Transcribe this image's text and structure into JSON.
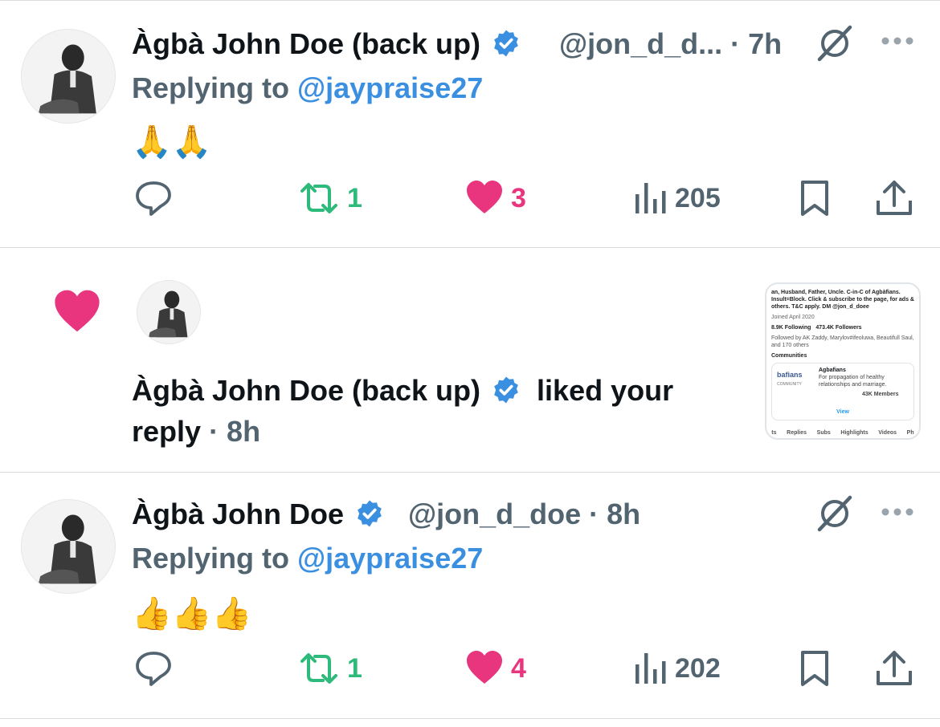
{
  "colors": {
    "accent": "#3b8fe0",
    "like": "#e8357e",
    "retweet": "#2dba7a",
    "muted": "#536471"
  },
  "tweet1": {
    "name": "Àgbà John Doe (back up)",
    "handle": "@jon_d_d...",
    "time": "· 7h",
    "replying_prefix": "Replying to ",
    "replying_handle": "@jaypraise27",
    "body": "🙏🙏",
    "retweets": "1",
    "likes": "3",
    "views": "205"
  },
  "notification": {
    "name": "Àgbà John Doe (back up)",
    "text_after": "liked your",
    "text_line2": "reply",
    "time": "· 8h",
    "thumb": {
      "bio": "an, Husband, Father, Uncle. C-in-C of Agbàfians. Insult=Block. Click & subscribe to the page, for ads & others. T&C apply. DM @jon_d_doee",
      "joined": "Joined April 2020",
      "following": "8.9K Following",
      "followers": "473.4K Followers",
      "followed_by": "Followed by AK Zaddy, Marylov#ifeoluwa, Beautifull Saul, and 170 others",
      "communities": "Communities",
      "community_name": "Agbafians",
      "community_desc": "For propagation of healthy relationships and marriage.",
      "community_logo": "bafians",
      "community_sub": "COMMUNITY",
      "members": "43K Members",
      "view": "View",
      "tabs": [
        "ts",
        "Replies",
        "Subs",
        "Highlights",
        "Videos",
        "Ph"
      ]
    }
  },
  "tweet2": {
    "name": "Àgbà John Doe",
    "handle": "@jon_d_doe",
    "time": "· 8h",
    "replying_prefix": "Replying to ",
    "replying_handle": "@jaypraise27",
    "body": "👍👍👍",
    "retweets": "1",
    "likes": "4",
    "views": "202"
  }
}
